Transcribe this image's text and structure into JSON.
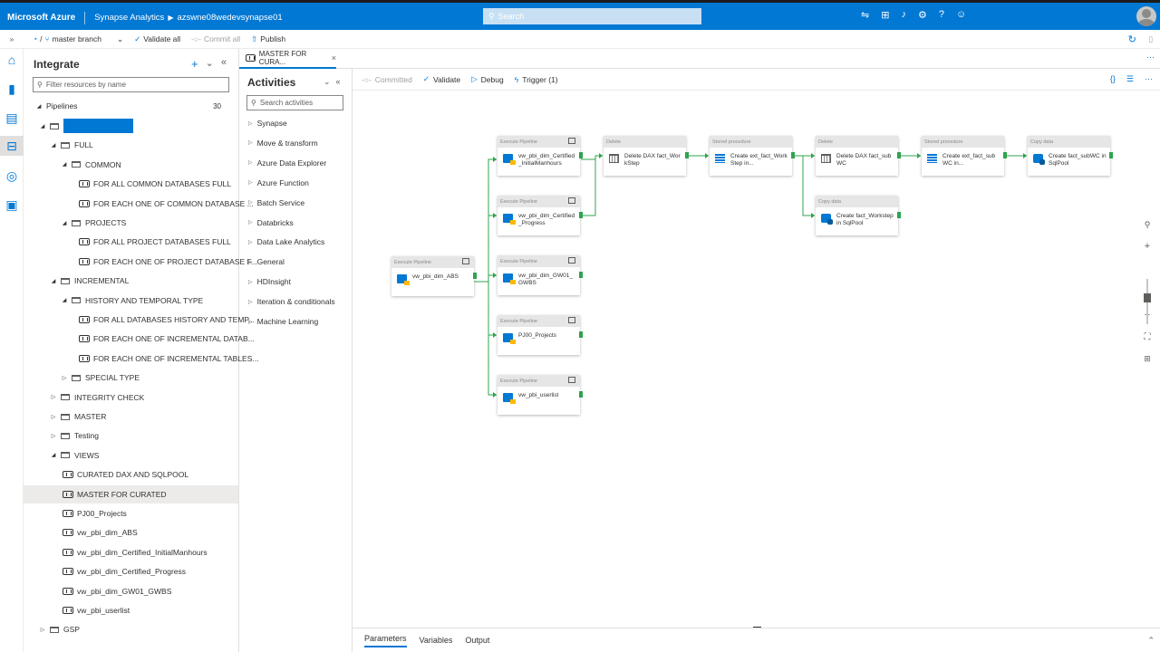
{
  "topbar": {
    "brand": "Microsoft Azure",
    "service": "Synapse Analytics",
    "workspace": "azswne08wedevsynapse01",
    "search_placeholder": "Search",
    "icons": [
      "feedback-icon",
      "directory-icon",
      "bell-icon",
      "gear-icon",
      "help-icon",
      "smile-icon"
    ]
  },
  "toolbar": {
    "branch": "master branch",
    "validate_all": "Validate all",
    "commit_all": "Commit all",
    "publish": "Publish"
  },
  "resources": {
    "title": "Integrate",
    "filter_placeholder": "Filter resources by name",
    "pipelines_label": "Pipelines",
    "pipelines_count": "30",
    "tree": [
      {
        "label": "",
        "kind": "folder",
        "level": 1,
        "expanded": true,
        "redacted": true
      },
      {
        "label": "FULL",
        "kind": "folder",
        "level": 2,
        "expanded": true
      },
      {
        "label": "COMMON",
        "kind": "folder",
        "level": 3,
        "expanded": true
      },
      {
        "label": "FOR ALL COMMON DATABASES FULL",
        "kind": "pipeline",
        "level": 4
      },
      {
        "label": "FOR EACH ONE OF COMMON DATABASE ...",
        "kind": "pipeline",
        "level": 4
      },
      {
        "label": "PROJECTS",
        "kind": "folder",
        "level": 3,
        "expanded": true
      },
      {
        "label": "FOR ALL PROJECT DATABASES FULL",
        "kind": "pipeline",
        "level": 4
      },
      {
        "label": "FOR EACH ONE OF PROJECT DATABASE F...",
        "kind": "pipeline",
        "level": 4
      },
      {
        "label": "INCREMENTAL",
        "kind": "folder",
        "level": 2,
        "expanded": true
      },
      {
        "label": "HISTORY AND TEMPORAL TYPE",
        "kind": "folder",
        "level": 3,
        "expanded": true
      },
      {
        "label": "FOR ALL DATABASES HISTORY AND TEMP...",
        "kind": "pipeline",
        "level": 4
      },
      {
        "label": "FOR EACH ONE OF INCREMENTAL DATAB...",
        "kind": "pipeline",
        "level": 4
      },
      {
        "label": "FOR EACH ONE OF INCREMENTAL TABLES...",
        "kind": "pipeline",
        "level": 4
      },
      {
        "label": "SPECIAL TYPE",
        "kind": "folder",
        "level": 3,
        "expanded": false
      },
      {
        "label": "INTEGRITY CHECK",
        "kind": "folder",
        "level": 2,
        "expanded": false
      },
      {
        "label": "MASTER",
        "kind": "folder",
        "level": 2,
        "expanded": false
      },
      {
        "label": "Testing",
        "kind": "folder",
        "level": 2,
        "expanded": false
      },
      {
        "label": "VIEWS",
        "kind": "folder",
        "level": 2,
        "expanded": true
      },
      {
        "label": "CURATED DAX AND SQLPOOL",
        "kind": "pipeline",
        "level": 3
      },
      {
        "label": "MASTER FOR CURATED",
        "kind": "pipeline",
        "level": 3,
        "selected": true
      },
      {
        "label": "PJ00_Projects",
        "kind": "pipeline",
        "level": 3
      },
      {
        "label": "vw_pbi_dim_ABS",
        "kind": "pipeline",
        "level": 3
      },
      {
        "label": "vw_pbi_dim_Certified_InitialManhours",
        "kind": "pipeline",
        "level": 3
      },
      {
        "label": "vw_pbi_dim_Certified_Progress",
        "kind": "pipeline",
        "level": 3
      },
      {
        "label": "vw_pbi_dim_GW01_GWBS",
        "kind": "pipeline",
        "level": 3
      },
      {
        "label": "vw_pbi_userlist",
        "kind": "pipeline",
        "level": 3
      },
      {
        "label": "GSP",
        "kind": "folder",
        "level": 1,
        "expanded": false
      }
    ]
  },
  "tab": {
    "label": "MASTER FOR CURA...",
    "close": "×"
  },
  "activities": {
    "title": "Activities",
    "search_placeholder": "Search activities",
    "items": [
      "Synapse",
      "Move & transform",
      "Azure Data Explorer",
      "Azure Function",
      "Batch Service",
      "Databricks",
      "Data Lake Analytics",
      "General",
      "HDInsight",
      "Iteration & conditionals",
      "Machine Learning"
    ]
  },
  "canvas_toolbar": {
    "committed": "Committed",
    "validate": "Validate",
    "debug": "Debug",
    "trigger": "Trigger (1)"
  },
  "nodes": [
    {
      "id": "n_abs",
      "header": "Execute Pipeline",
      "name": "vw_pbi_dim_ABS",
      "icon": "execute-pipeline-icon"
    },
    {
      "id": "n_cim",
      "header": "Execute Pipeline",
      "name": "vw_pbi_dim_Certified_InitialManhours",
      "icon": "execute-pipeline-icon"
    },
    {
      "id": "n_cp",
      "header": "Execute Pipeline",
      "name": "vw_pbi_dim_Certified_Progress",
      "icon": "execute-pipeline-icon"
    },
    {
      "id": "n_gw",
      "header": "Execute Pipeline",
      "name": "vw_pbi_dim_GW01_GWBS",
      "icon": "execute-pipeline-icon"
    },
    {
      "id": "n_pj",
      "header": "Execute Pipeline",
      "name": "PJ00_Projects",
      "icon": "execute-pipeline-icon"
    },
    {
      "id": "n_ul",
      "header": "Execute Pipeline",
      "name": "vw_pbi_userlist",
      "icon": "execute-pipeline-icon"
    },
    {
      "id": "n_del1",
      "header": "Delete",
      "name": "Delete DAX fact_WorkStep",
      "icon": "delete-icon"
    },
    {
      "id": "n_sp1",
      "header": "Stored procedure",
      "name": "Create ext_fact_WorkStep in...",
      "icon": "stored-procedure-icon"
    },
    {
      "id": "n_del2",
      "header": "Delete",
      "name": "Delete DAX fact_subWC",
      "icon": "delete-icon"
    },
    {
      "id": "n_copy1",
      "header": "Copy data",
      "name": "Create fact_Workstep in SqlPool",
      "icon": "copy-data-icon"
    },
    {
      "id": "n_sp2",
      "header": "Stored procedure",
      "name": "Create ext_fact_subWC in...",
      "icon": "stored-procedure-icon"
    },
    {
      "id": "n_copy2",
      "header": "Copy data",
      "name": "Create fact_subWC in SqlPool",
      "icon": "copy-data-icon"
    }
  ],
  "bottom_tabs": [
    "Parameters",
    "Variables",
    "Output"
  ],
  "colors": {
    "azure_blue": "#0078d4",
    "success_green": "#2da44e"
  }
}
